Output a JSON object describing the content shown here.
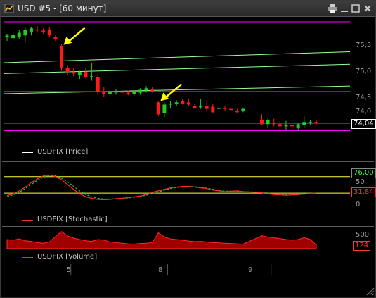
{
  "window": {
    "title": "USD #5 - [60 минут]"
  },
  "price_pane": {
    "legend": "USDFIX [Price]",
    "axis_ticks": [
      "75,5",
      "75,0",
      "74,5",
      "74,0"
    ],
    "last_value": "74,04"
  },
  "stoch_pane": {
    "legend": "USDFIX [Stochastic]",
    "axis_ticks": [
      "50",
      "0"
    ],
    "upper_value": "76,00",
    "last_value": "31,84"
  },
  "volume_pane": {
    "legend": "USDFIX [Volume]",
    "axis_ticks": [
      "500"
    ],
    "last_value": "124"
  },
  "time_axis": {
    "labels": [
      "5",
      "8",
      "9"
    ]
  },
  "colors": {
    "up": "#22cc22",
    "down": "#ff1a1a",
    "magenta": "#ff00ff",
    "green_line": "#99ff99",
    "yellow": "#ffff33",
    "white": "#ffffff",
    "red_stoch": "#ff2a2a"
  },
  "chart_data": {
    "type": "candlestick",
    "title": "",
    "interval": "60 минут",
    "ylim": [
      73.7,
      75.9
    ],
    "y_ticks": [
      75.5,
      75.0,
      74.5,
      74.0
    ],
    "candles": [
      {
        "o": 75.62,
        "h": 75.68,
        "l": 75.55,
        "c": 75.65
      },
      {
        "o": 75.6,
        "h": 75.7,
        "l": 75.55,
        "c": 75.66
      },
      {
        "o": 75.62,
        "h": 75.75,
        "l": 75.58,
        "c": 75.7
      },
      {
        "o": 75.65,
        "h": 75.8,
        "l": 75.52,
        "c": 75.75
      },
      {
        "o": 75.72,
        "h": 75.8,
        "l": 75.65,
        "c": 75.78
      },
      {
        "o": 75.76,
        "h": 75.82,
        "l": 75.7,
        "c": 75.74
      },
      {
        "o": 75.74,
        "h": 75.78,
        "l": 75.68,
        "c": 75.72
      },
      {
        "o": 75.76,
        "h": 75.8,
        "l": 75.62,
        "c": 75.65
      },
      {
        "o": 75.62,
        "h": 75.65,
        "l": 75.55,
        "c": 75.58
      },
      {
        "o": 75.45,
        "h": 75.5,
        "l": 75.0,
        "c": 75.05
      },
      {
        "o": 75.05,
        "h": 75.1,
        "l": 74.92,
        "c": 74.98
      },
      {
        "o": 74.98,
        "h": 75.05,
        "l": 74.9,
        "c": 74.95
      },
      {
        "o": 74.92,
        "h": 75.0,
        "l": 74.85,
        "c": 74.98
      },
      {
        "o": 74.98,
        "h": 75.05,
        "l": 74.86,
        "c": 74.88
      },
      {
        "o": 74.88,
        "h": 75.15,
        "l": 74.82,
        "c": 74.9
      },
      {
        "o": 74.88,
        "h": 74.95,
        "l": 74.55,
        "c": 74.62
      },
      {
        "o": 74.62,
        "h": 74.7,
        "l": 74.52,
        "c": 74.58
      },
      {
        "o": 74.58,
        "h": 74.65,
        "l": 74.54,
        "c": 74.62
      },
      {
        "o": 74.6,
        "h": 74.66,
        "l": 74.56,
        "c": 74.62
      },
      {
        "o": 74.62,
        "h": 74.66,
        "l": 74.58,
        "c": 74.6
      },
      {
        "o": 74.6,
        "h": 74.64,
        "l": 74.55,
        "c": 74.58
      },
      {
        "o": 74.58,
        "h": 74.64,
        "l": 74.54,
        "c": 74.62
      },
      {
        "o": 74.6,
        "h": 74.68,
        "l": 74.56,
        "c": 74.65
      },
      {
        "o": 74.64,
        "h": 74.72,
        "l": 74.6,
        "c": 74.68
      },
      {
        "o": 74.66,
        "h": 74.7,
        "l": 74.6,
        "c": 74.62
      },
      {
        "o": 74.42,
        "h": 74.45,
        "l": 74.18,
        "c": 74.2
      },
      {
        "o": 74.22,
        "h": 74.42,
        "l": 74.15,
        "c": 74.38
      },
      {
        "o": 74.38,
        "h": 74.45,
        "l": 74.32,
        "c": 74.4
      },
      {
        "o": 74.4,
        "h": 74.46,
        "l": 74.36,
        "c": 74.42
      },
      {
        "o": 74.44,
        "h": 74.48,
        "l": 74.38,
        "c": 74.4
      },
      {
        "o": 74.42,
        "h": 74.48,
        "l": 74.36,
        "c": 74.38
      },
      {
        "o": 74.36,
        "h": 74.4,
        "l": 74.3,
        "c": 74.32
      },
      {
        "o": 74.34,
        "h": 74.48,
        "l": 74.3,
        "c": 74.35
      },
      {
        "o": 74.36,
        "h": 74.46,
        "l": 74.24,
        "c": 74.3
      },
      {
        "o": 74.34,
        "h": 74.4,
        "l": 74.22,
        "c": 74.24
      },
      {
        "o": 74.3,
        "h": 74.36,
        "l": 74.26,
        "c": 74.32
      },
      {
        "o": 74.32,
        "h": 74.35,
        "l": 74.26,
        "c": 74.3
      },
      {
        "o": 74.3,
        "h": 74.33,
        "l": 74.25,
        "c": 74.28
      },
      {
        "o": 74.26,
        "h": 74.3,
        "l": 74.22,
        "c": 74.25
      },
      {
        "o": 74.26,
        "h": 74.32,
        "l": 74.24,
        "c": 74.3
      },
      {
        "o": 74.1,
        "h": 74.2,
        "l": 74.0,
        "c": 74.02
      },
      {
        "o": 74.02,
        "h": 74.12,
        "l": 73.95,
        "c": 74.1
      },
      {
        "o": 74.05,
        "h": 74.12,
        "l": 73.98,
        "c": 74.02
      },
      {
        "o": 74.02,
        "h": 74.08,
        "l": 73.92,
        "c": 73.98
      },
      {
        "o": 73.98,
        "h": 74.08,
        "l": 73.92,
        "c": 74.0
      },
      {
        "o": 74.0,
        "h": 74.04,
        "l": 73.93,
        "c": 73.98
      },
      {
        "o": 73.96,
        "h": 74.04,
        "l": 73.9,
        "c": 74.02
      },
      {
        "o": 74.0,
        "h": 74.16,
        "l": 73.96,
        "c": 74.06
      },
      {
        "o": 74.05,
        "h": 74.1,
        "l": 74.0,
        "c": 74.06
      },
      {
        "o": 74.06,
        "h": 74.1,
        "l": 74.02,
        "c": 74.04
      }
    ],
    "horizontal_lines": [
      {
        "y": 75.9,
        "color": "magenta"
      },
      {
        "y": 74.62,
        "color": "magenta"
      },
      {
        "y": 73.9,
        "color": "magenta"
      },
      {
        "y": 74.04,
        "color": "white"
      }
    ],
    "channel_lines": [
      {
        "y_start": 75.15,
        "y_end": 75.35
      },
      {
        "y_start": 74.95,
        "y_end": 75.12
      },
      {
        "y_start": 74.58,
        "y_end": 74.72
      }
    ],
    "arrow_candles": [
      9,
      25
    ],
    "stochastic": {
      "levels": [
        76,
        31.84
      ],
      "k": [
        25,
        30,
        38,
        48,
        60,
        70,
        78,
        80,
        76,
        68,
        55,
        42,
        30,
        22,
        18,
        15,
        14,
        15,
        17,
        18,
        20,
        22,
        24,
        28,
        34,
        38,
        42,
        46,
        48,
        50,
        50,
        48,
        46,
        44,
        40,
        38,
        36,
        37,
        38,
        36,
        33,
        30,
        28,
        27,
        26,
        27,
        28,
        30,
        31,
        32
      ],
      "d": [
        22,
        27,
        34,
        44,
        55,
        66,
        74,
        79,
        78,
        72,
        62,
        50,
        38,
        28,
        22,
        18,
        16,
        16,
        17,
        18,
        19,
        21,
        23,
        26,
        31,
        35,
        40,
        44,
        47,
        49,
        50,
        49,
        47,
        45,
        42,
        39,
        37,
        37,
        37,
        36,
        34,
        32,
        30,
        28,
        27,
        27,
        28,
        29,
        30,
        31
      ]
    },
    "volume": [
      300,
      280,
      320,
      260,
      240,
      200,
      180,
      220,
      400,
      560,
      420,
      350,
      300,
      260,
      240,
      300,
      280,
      220,
      200,
      180,
      160,
      150,
      170,
      180,
      200,
      520,
      380,
      320,
      300,
      280,
      250,
      230,
      240,
      220,
      200,
      190,
      180,
      170,
      160,
      150,
      420,
      380,
      360,
      330,
      300,
      280,
      300,
      360,
      300,
      124
    ],
    "x_labels": [
      {
        "index": 11,
        "label": "5"
      },
      {
        "index": 27,
        "label": "8"
      },
      {
        "index": 42,
        "label": "9"
      }
    ]
  }
}
